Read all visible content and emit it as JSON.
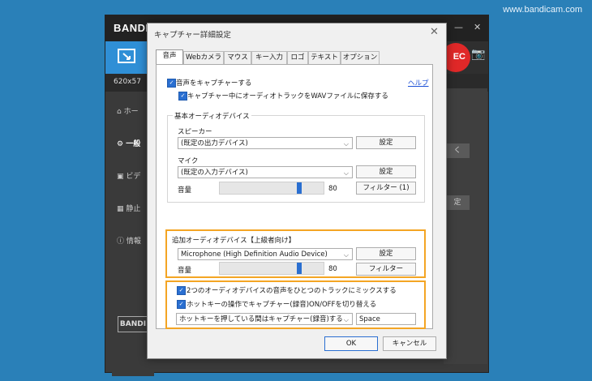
{
  "watermark": "www.bandicam.com",
  "app": {
    "logo": "BANDIC",
    "size_text": "620x57",
    "rec_label": "EC",
    "bottom_logo": "BANDI",
    "sidebar": [
      {
        "label": "ホー"
      },
      {
        "label": "一般"
      },
      {
        "label": "ビデ"
      },
      {
        "label": "静止"
      },
      {
        "label": "情報"
      }
    ],
    "right_buttons": [
      "く",
      "定"
    ]
  },
  "dialog": {
    "title": "キャプチャー詳細設定",
    "tabs": [
      "音声",
      "Webカメラ",
      "マウス",
      "キー入力",
      "ロゴ",
      "テキスト",
      "オプション"
    ],
    "record_audio_label": "音声をキャプチャーする",
    "help_link": "ヘルプ",
    "save_wav_label": "キャプチャー中にオーディオトラックをWAVファイルに保存する",
    "basic_group_title": "基本オーディオデバイス",
    "speaker_label": "スピーカー",
    "speaker_value": "(既定の出力デバイス)",
    "settings_label": "設定",
    "mic_label": "マイク",
    "mic_value": "(既定の入力デバイス)",
    "volume_label": "音量",
    "volume_value": "80",
    "volume_level": 0.8,
    "filter_label_1": "フィルター (1)",
    "extra_group_title": "追加オーディオデバイス【上級者向け】",
    "extra_device_value": "Microphone (High Definition Audio Device)",
    "extra_volume_value": "80",
    "filter_label_2": "フィルター",
    "mix_label": "2つのオーディオデバイスの音声をひとつのトラックにミックスする",
    "hotkey_toggle_label": "ホットキーの操作でキャプチャー(録音)ON/OFFを切り替える",
    "hotkey_mode_value": "ホットキーを押している間はキャプチャー(録音)する",
    "hotkey_value": "Space",
    "ok_label": "OK",
    "cancel_label": "キャンセル"
  },
  "colors": {
    "background": "#2a80b8",
    "accent": "#2a6fd1",
    "highlight": "#f4a524",
    "rec": "#e02828"
  }
}
